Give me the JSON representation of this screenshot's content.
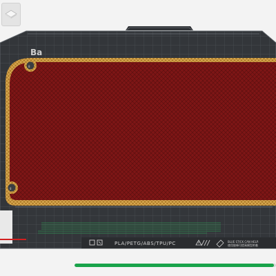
{
  "colors": {
    "background": "#f3f3f3",
    "plate": "#33363a",
    "grid_line": "#4e5358",
    "model_fill": "#7e1616",
    "model_border": "#b07d2a",
    "progress": "#19a34a",
    "accent_red": "#d21f1f"
  },
  "plate": {
    "corner_label": "Ba",
    "filament_types": "PLA/PETG/ABS/TPU/PC",
    "hint_title": "BLUE STICK CAN HELP.",
    "hint_subtitle": "使用胶棒可提高模型附着"
  },
  "progress": {
    "fraction": 0.99
  },
  "icons": {
    "thumbnail": "object-thumbnail-icon",
    "printer_mode": "printer-mode-icon",
    "glue_stick": "glue-stick-icon",
    "warning": "warning-icon"
  }
}
